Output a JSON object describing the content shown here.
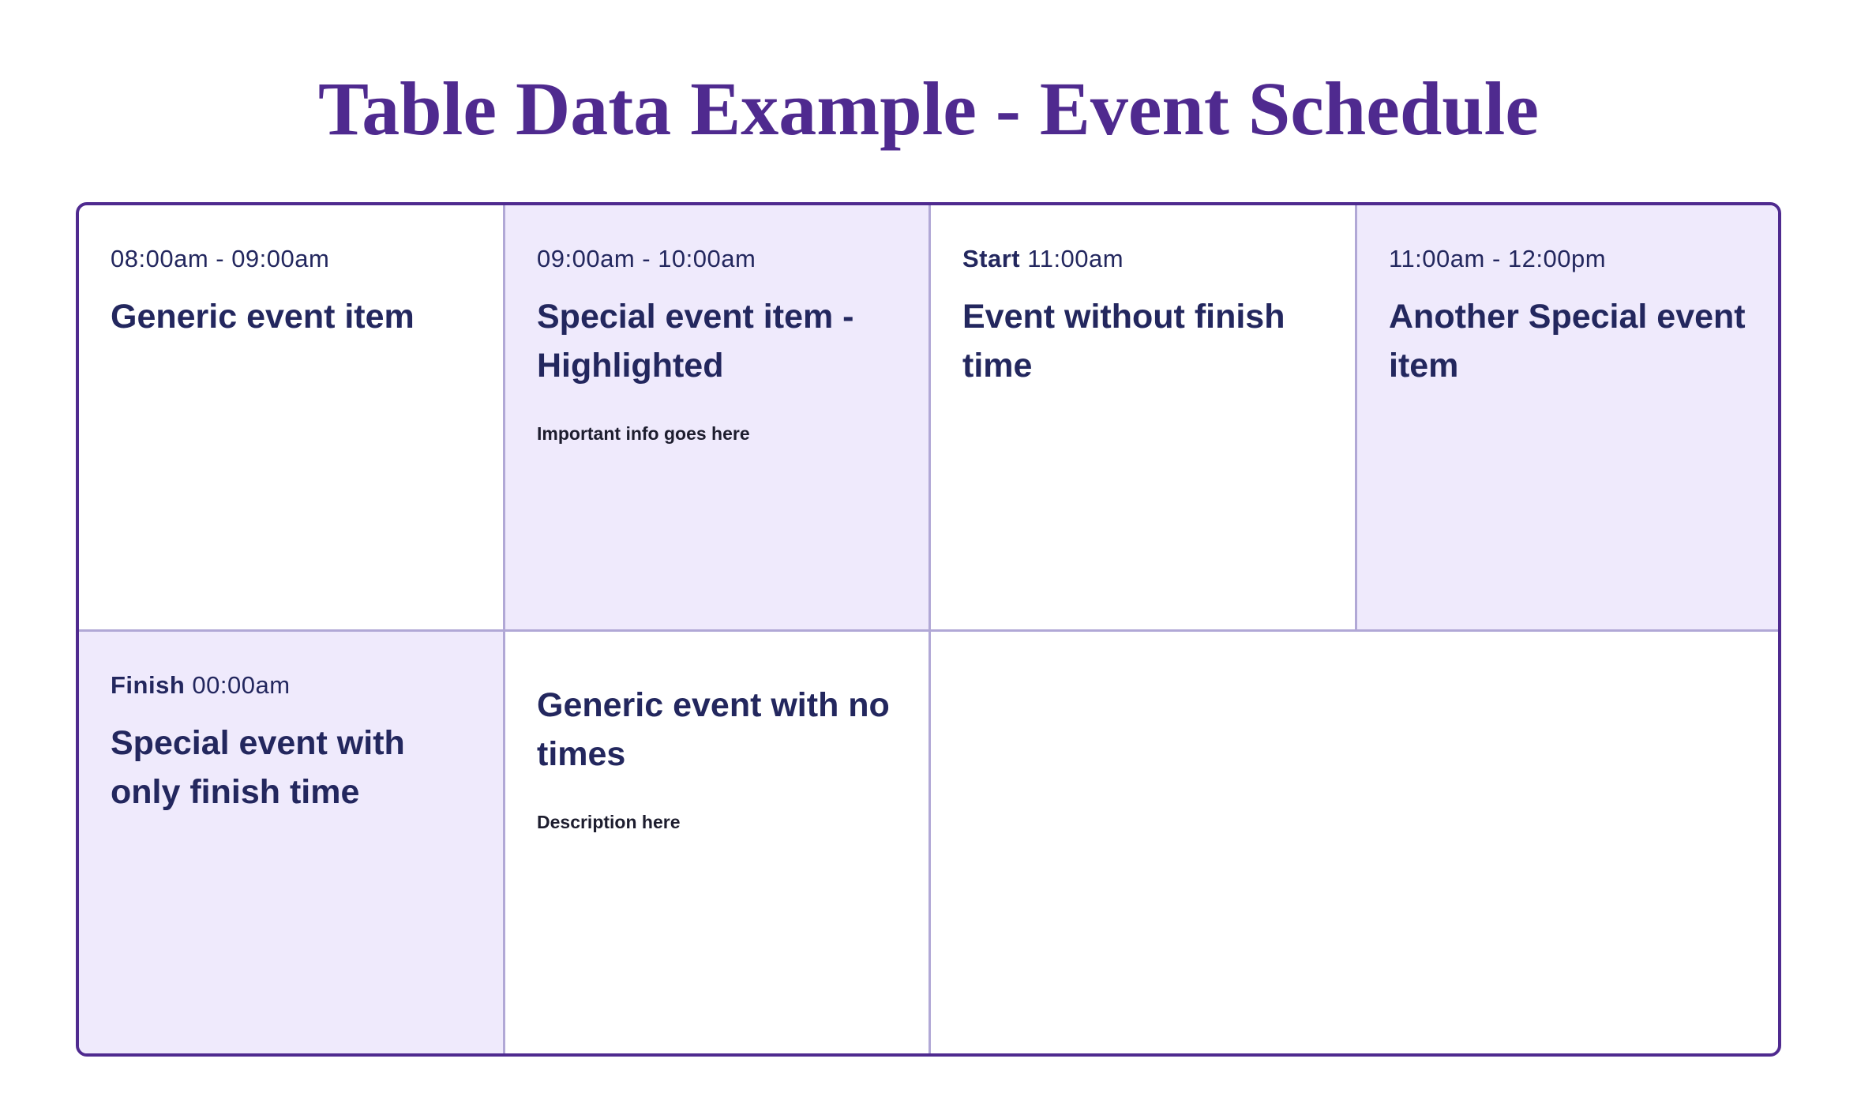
{
  "page": {
    "title": "Table Data Example - Event Schedule"
  },
  "colors": {
    "title": "#4f2a8f",
    "border": "#4f2a8f",
    "cell_divider": "#b1a8d6",
    "highlight_bg": "#efeafc",
    "event_text": "#23275e"
  },
  "events": [
    {
      "time": "08:00am - 09:00am",
      "title": "Generic event item",
      "highlighted": false
    },
    {
      "time": "09:00am - 10:00am",
      "title": "Special event item - Highlighted",
      "description": "Important info goes here",
      "highlighted": true
    },
    {
      "time_label": "Start",
      "time": "11:00am",
      "title": "Event without finish time",
      "highlighted": false
    },
    {
      "time": "11:00am - 12:00pm",
      "title": "Another Special event item",
      "highlighted": true
    },
    {
      "time_label": "Finish",
      "time": "00:00am",
      "title": "Special event with only finish time",
      "highlighted": true
    },
    {
      "title": "Generic event with no times",
      "description": "Description here",
      "highlighted": false
    }
  ]
}
